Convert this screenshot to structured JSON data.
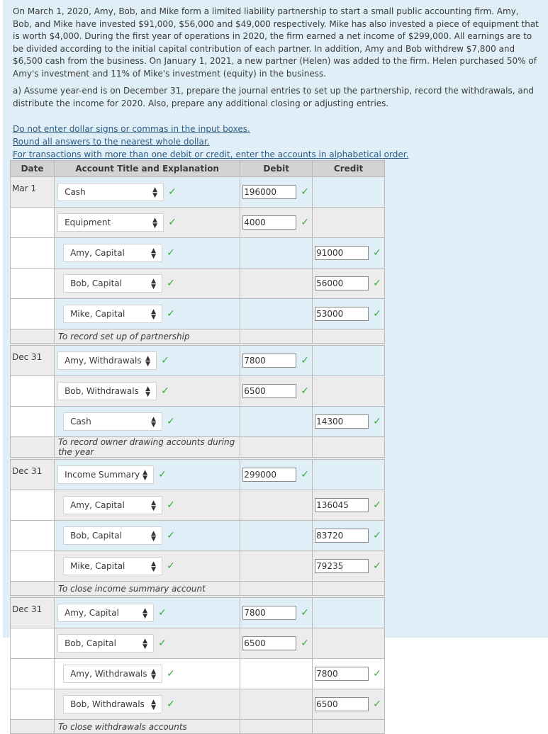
{
  "problem_text": "On March 1, 2020, Amy, Bob, and Mike form a limited liability partnership to start a small public accounting firm. Amy, Bob, and Mike have invested $91,000, $56,000 and $49,000 respectively. Mike has also invested a piece of equipment that is worth $4,000. During the first year of operations in 2020, the firm earned a net income of $299,000. All earnings are to be divided according to the initial capital contribution of each partner. In addition, Amy and Bob withdrew $7,800 and $6,500 cash from the business. On January 1, 2021, a new partner (Helen) was added to the firm. Helen purchased 50% of Amy's investment and 11% of Mike's investment (equity) in the business.",
  "part_a": "a) Assume year-end is on December 31, prepare the journal entries to set up the partnership, record the withdrawals, and distribute the income for 2020. Also, prepare any additional closing or adjusting entries.",
  "instructions": [
    "Do not enter dollar signs or commas in the input boxes.",
    "Round all answers to the nearest whole dollar.",
    "For transactions with more than one debit or credit, enter the accounts in alphabetical order."
  ],
  "table_headers": {
    "date": "Date",
    "account": "Account Title and Explanation",
    "debit": "Debit",
    "credit": "Credit"
  },
  "check_glyph": "✓",
  "entries": [
    {
      "date": "Mar 1",
      "lines": [
        {
          "account": "Cash",
          "debit": "196000",
          "credit": ""
        },
        {
          "account": "Equipment",
          "debit": "4000",
          "credit": ""
        },
        {
          "account": "Amy, Capital",
          "debit": "",
          "credit": "91000"
        },
        {
          "account": "Bob, Capital",
          "debit": "",
          "credit": "56000"
        },
        {
          "account": "Mike, Capital",
          "debit": "",
          "credit": "53000"
        }
      ],
      "memo": "To record set up of partnership"
    },
    {
      "date": "Dec 31",
      "lines": [
        {
          "account": "Amy, Withdrawals",
          "debit": "7800",
          "credit": ""
        },
        {
          "account": "Bob, Withdrawals",
          "debit": "6500",
          "credit": ""
        },
        {
          "account": "Cash",
          "debit": "",
          "credit": "14300"
        }
      ],
      "memo": "To record owner drawing accounts during the year"
    },
    {
      "date": "Dec 31",
      "lines": [
        {
          "account": "Income Summary",
          "debit": "299000",
          "credit": ""
        },
        {
          "account": "Amy, Capital",
          "debit": "",
          "credit": "136045"
        },
        {
          "account": "Bob, Capital",
          "debit": "",
          "credit": "83720"
        },
        {
          "account": "Mike, Capital",
          "debit": "",
          "credit": "79235"
        }
      ],
      "memo": "To close income summary account"
    },
    {
      "date": "Dec 31",
      "lines": [
        {
          "account": "Amy, Capital",
          "debit": "7800",
          "credit": ""
        },
        {
          "account": "Bob, Capital",
          "debit": "6500",
          "credit": ""
        },
        {
          "account": "Amy, Withdrawals",
          "debit": "",
          "credit": "7800"
        },
        {
          "account": "Bob, Withdrawals",
          "debit": "",
          "credit": "6500"
        }
      ],
      "memo": "To close withdrawals accounts"
    }
  ]
}
